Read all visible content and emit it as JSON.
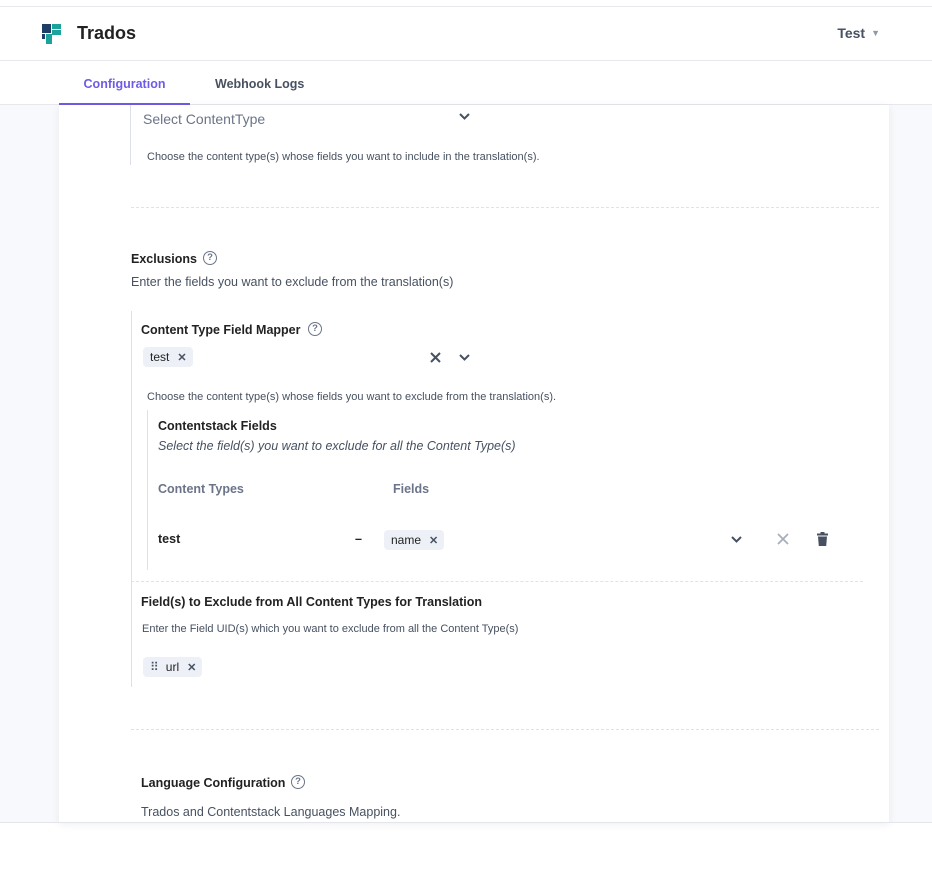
{
  "header": {
    "brand": "Trados",
    "user": "Test"
  },
  "tabs": [
    {
      "label": "Configuration",
      "active": true
    },
    {
      "label": "Webhook Logs",
      "active": false
    }
  ],
  "content_type_select": {
    "placeholder": "Select ContentType",
    "hint": "Choose the content type(s) whose fields you want to include in the translation(s)."
  },
  "exclusions": {
    "title": "Exclusions",
    "description": "Enter the fields you want to exclude from the translation(s)",
    "mapper": {
      "title": "Content Type Field Mapper",
      "selected": [
        "test"
      ],
      "hint": "Choose the content type(s) whose fields you want to exclude from the translation(s).",
      "contentstack_fields": {
        "title": "Contentstack Fields",
        "subtitle": "Select the field(s) you want to exclude for all the Content Type(s)",
        "col_content_types": "Content Types",
        "col_fields": "Fields",
        "rows": [
          {
            "content_type": "test",
            "separator": "–",
            "fields": [
              "name"
            ]
          }
        ]
      }
    },
    "exclude_all": {
      "title": "Field(s) to Exclude from All Content Types for Translation",
      "hint": "Enter the Field UID(s) which you want to exclude from all the Content Type(s)",
      "tags": [
        "url"
      ]
    }
  },
  "language": {
    "title": "Language Configuration",
    "description": "Trados and Contentstack Languages Mapping."
  },
  "icons": {
    "logo": "trados-logo-icon",
    "caret": "caret-down-icon",
    "chevron": "chevron-down-icon",
    "clear": "clear-icon",
    "remove": "close-icon",
    "trash": "trash-icon",
    "help": "help-circle-icon",
    "drag": "drag-handle-icon"
  },
  "colors": {
    "accent": "#6c5ce7",
    "logo_teal": "#1aa39a",
    "logo_dark": "#1d3f66",
    "text": "#222222",
    "muted": "#475161"
  }
}
